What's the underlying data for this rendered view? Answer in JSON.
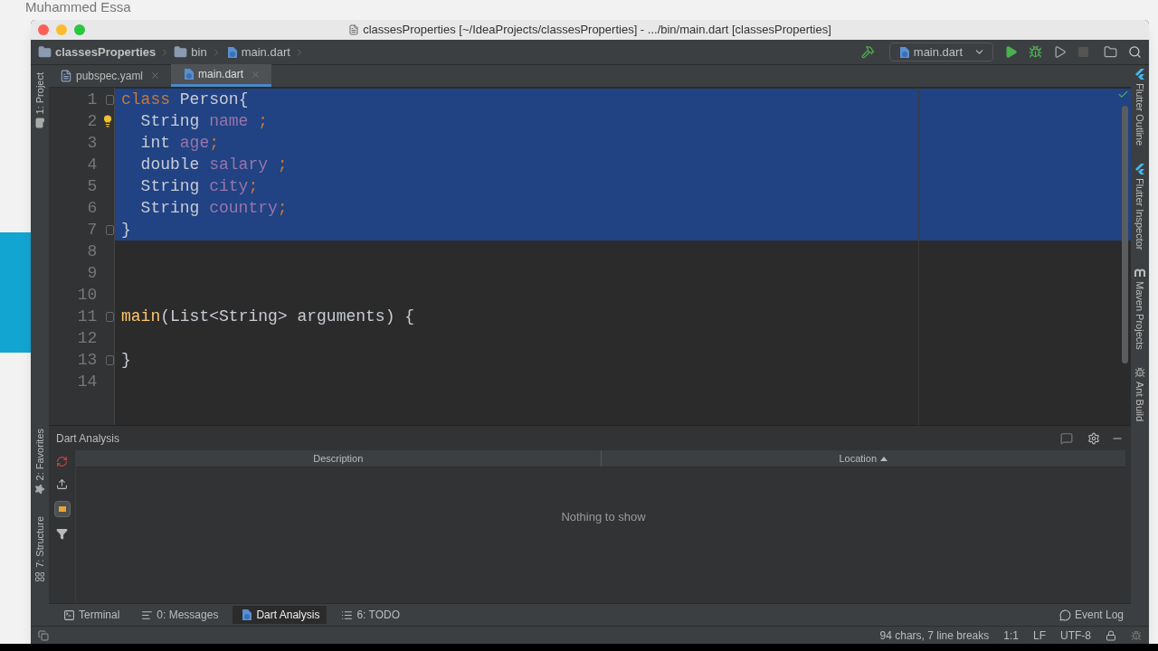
{
  "background": {
    "author": "Muhammed Essa"
  },
  "window": {
    "title": "classesProperties [~/IdeaProjects/classesProperties] - .../bin/main.dart [classesProperties]"
  },
  "breadcrumbs": [
    {
      "label": "classesProperties",
      "kind": "project"
    },
    {
      "label": "bin",
      "kind": "folder"
    },
    {
      "label": "main.dart",
      "kind": "dart"
    }
  ],
  "run_config": {
    "label": "main.dart"
  },
  "editor_tabs": [
    {
      "label": "pubspec.yaml",
      "kind": "yaml",
      "selected": false
    },
    {
      "label": "main.dart",
      "kind": "dart",
      "selected": true
    }
  ],
  "left_tool_windows": {
    "top": [
      {
        "label": "1: Project",
        "kind": "folder"
      }
    ],
    "bottom": [
      {
        "label": "2: Favorites",
        "kind": "star"
      },
      {
        "label": "7: Structure",
        "kind": "structure"
      }
    ]
  },
  "right_tool_windows": [
    {
      "label": "Flutter Outline",
      "kind": "flutter"
    },
    {
      "label": "Flutter Inspector",
      "kind": "flutter"
    },
    {
      "label": "Maven Projects",
      "kind": "maven"
    },
    {
      "label": "Ant Build",
      "kind": "ant"
    }
  ],
  "code_lines": [
    {
      "number": "1",
      "selected": true,
      "fold": true,
      "hint": false,
      "tokens": [
        {
          "text": "class",
          "kind": "keyword"
        },
        {
          "text": " Person{",
          "kind": "plain"
        }
      ]
    },
    {
      "number": "2",
      "selected": true,
      "fold": false,
      "hint": true,
      "tokens": [
        {
          "text": "  String ",
          "kind": "plain"
        },
        {
          "text": "name",
          "kind": "field"
        },
        {
          "text": " ;",
          "kind": "punct"
        }
      ]
    },
    {
      "number": "3",
      "selected": true,
      "fold": false,
      "hint": false,
      "tokens": [
        {
          "text": "  int ",
          "kind": "plain"
        },
        {
          "text": "age",
          "kind": "field"
        },
        {
          "text": ";",
          "kind": "punct"
        }
      ]
    },
    {
      "number": "4",
      "selected": true,
      "fold": false,
      "hint": false,
      "tokens": [
        {
          "text": "  double ",
          "kind": "plain"
        },
        {
          "text": "salary",
          "kind": "field"
        },
        {
          "text": " ;",
          "kind": "punct"
        }
      ]
    },
    {
      "number": "5",
      "selected": true,
      "fold": false,
      "hint": false,
      "tokens": [
        {
          "text": "  String ",
          "kind": "plain"
        },
        {
          "text": "city",
          "kind": "field"
        },
        {
          "text": ";",
          "kind": "punct"
        }
      ]
    },
    {
      "number": "6",
      "selected": true,
      "fold": false,
      "hint": false,
      "tokens": [
        {
          "text": "  String ",
          "kind": "plain"
        },
        {
          "text": "country",
          "kind": "field"
        },
        {
          "text": ";",
          "kind": "punct"
        }
      ]
    },
    {
      "number": "7",
      "selected": true,
      "fold": true,
      "hint": false,
      "tokens": [
        {
          "text": "}",
          "kind": "plain"
        }
      ]
    },
    {
      "number": "8",
      "selected": false,
      "fold": false,
      "hint": false
    },
    {
      "number": "9",
      "selected": false,
      "fold": false,
      "hint": false
    },
    {
      "number": "10",
      "selected": false,
      "fold": false,
      "hint": false
    },
    {
      "number": "11",
      "selected": false,
      "fold": true,
      "hint": false,
      "tokens": [
        {
          "text": "main",
          "kind": "function"
        },
        {
          "text": "(List<String> arguments) {",
          "kind": "plain"
        }
      ]
    },
    {
      "number": "12",
      "selected": false,
      "fold": false,
      "hint": false
    },
    {
      "number": "13",
      "selected": false,
      "fold": true,
      "hint": false,
      "tokens": [
        {
          "text": "}",
          "kind": "plain"
        }
      ]
    },
    {
      "number": "14",
      "selected": false,
      "fold": false,
      "hint": false
    }
  ],
  "panel": {
    "title": "Dart Analysis",
    "columns": [
      {
        "label": "Description",
        "sorted": false
      },
      {
        "label": "Location",
        "sorted": true
      }
    ],
    "empty_text": "Nothing to show"
  },
  "bottom_tabs": [
    {
      "label": "Terminal",
      "kind": "terminal",
      "selected": false
    },
    {
      "label": "0: Messages",
      "kind": "messages",
      "selected": false
    },
    {
      "label": "Dart Analysis",
      "kind": "dart",
      "selected": true
    },
    {
      "label": "6: TODO",
      "kind": "list",
      "selected": false
    }
  ],
  "event_log": "Event Log",
  "status": {
    "selection": "94 chars, 7 line breaks",
    "position": "1:1",
    "line_separator": "LF",
    "encoding": "UTF-8"
  }
}
